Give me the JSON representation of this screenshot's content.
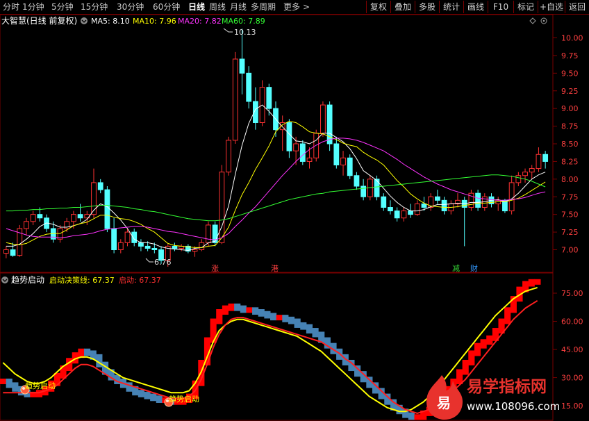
{
  "toolbar": {
    "periods": [
      "分时",
      "1分钟",
      "5分钟",
      "15分钟",
      "30分钟",
      "60分钟",
      "日线",
      "周线",
      "月线",
      "多周期",
      "更多"
    ],
    "active_period": "日线",
    "more_arrow": ">",
    "right_buttons": [
      "复权",
      "叠加",
      "多股",
      "统计",
      "画线",
      "F10",
      "标记",
      "+自选",
      "返回"
    ]
  },
  "main_panel": {
    "title": "大智慧(日线 前复权)",
    "ma": [
      {
        "label": "MA5: 8.10",
        "color": "#ffffff"
      },
      {
        "label": "MA10: 7.96",
        "color": "#ffff00"
      },
      {
        "label": "MA20: 7.82",
        "color": "#ff33ff"
      },
      {
        "label": "MA60: 7.89",
        "color": "#33ff33"
      }
    ],
    "high_label": "10.13",
    "low_label": "6.76",
    "yticks": [
      "10.00",
      "9.75",
      "9.50",
      "9.25",
      "9.00",
      "8.75",
      "8.50",
      "8.25",
      "8.00",
      "7.75",
      "7.50",
      "7.25",
      "7.00"
    ],
    "markers": [
      {
        "text": "涨",
        "color": "#ff4040"
      },
      {
        "text": "港",
        "color": "#ff4040"
      },
      {
        "text": "减",
        "color": "#33cc33"
      },
      {
        "text": "财",
        "color": "#3399ff"
      }
    ]
  },
  "sub_panel": {
    "title": "趋势启动",
    "line_label": "启动决策线: 67.37",
    "value_label": "启动: 67.37",
    "yticks": [
      "75.00",
      "60.00",
      "45.00",
      "30.00",
      "15.00"
    ],
    "signal_label": "趋势启动",
    "signal_label_2": "趋势启动"
  },
  "watermark": {
    "char": "易",
    "name": "易学指标网",
    "url": "www.108096.com"
  },
  "colors": {
    "up": "#ff3232",
    "down": "#54ffff",
    "grid_border": "#7a0000",
    "decision_line": "#ffff00",
    "start_line": "#ff2020",
    "bar_up": "#ff0000",
    "bar_down": "#4682b4"
  },
  "chart_data": [
    {
      "type": "candlestick",
      "title": "大智慧(日线 前复权)",
      "ylim": [
        6.7,
        10.3
      ],
      "ohlc": [
        [
          6.95,
          7.05,
          6.88,
          7.0
        ],
        [
          7.0,
          7.1,
          6.9,
          6.92
        ],
        [
          6.92,
          7.35,
          6.9,
          7.3
        ],
        [
          7.3,
          7.45,
          7.2,
          7.4
        ],
        [
          7.4,
          7.55,
          7.35,
          7.5
        ],
        [
          7.5,
          7.6,
          7.4,
          7.45
        ],
        [
          7.45,
          7.5,
          7.25,
          7.3
        ],
        [
          7.3,
          7.4,
          7.1,
          7.15
        ],
        [
          7.15,
          7.35,
          7.1,
          7.3
        ],
        [
          7.3,
          7.45,
          7.25,
          7.4
        ],
        [
          7.4,
          7.55,
          7.3,
          7.5
        ],
        [
          7.5,
          7.65,
          7.4,
          7.45
        ],
        [
          7.45,
          7.55,
          7.35,
          7.5
        ],
        [
          7.5,
          8.15,
          7.45,
          7.95
        ],
        [
          7.95,
          8.0,
          7.8,
          7.85
        ],
        [
          7.85,
          7.9,
          7.25,
          7.3
        ],
        [
          7.3,
          7.45,
          6.95,
          7.0
        ],
        [
          7.0,
          7.15,
          6.95,
          7.1
        ],
        [
          7.1,
          7.3,
          7.05,
          7.25
        ],
        [
          7.25,
          7.3,
          7.05,
          7.1
        ],
        [
          7.1,
          7.15,
          6.98,
          7.05
        ],
        [
          7.05,
          7.12,
          6.98,
          7.02
        ],
        [
          7.02,
          7.1,
          6.95,
          7.0
        ],
        [
          7.0,
          7.05,
          6.8,
          6.85
        ],
        [
          6.85,
          7.08,
          6.76,
          7.05
        ],
        [
          7.05,
          7.1,
          6.98,
          7.02
        ],
        [
          7.02,
          7.08,
          6.98,
          7.05
        ],
        [
          7.05,
          7.08,
          6.95,
          6.98
        ],
        [
          6.98,
          7.05,
          6.9,
          7.0
        ],
        [
          7.0,
          7.15,
          6.98,
          7.1
        ],
        [
          7.1,
          7.4,
          7.05,
          7.35
        ],
        [
          7.35,
          7.4,
          7.05,
          7.1
        ],
        [
          7.1,
          8.2,
          7.08,
          8.1
        ],
        [
          8.1,
          8.6,
          8.05,
          8.55
        ],
        [
          8.55,
          9.8,
          8.5,
          9.7
        ],
        [
          9.7,
          10.13,
          9.2,
          9.5
        ],
        [
          9.5,
          9.6,
          9.0,
          9.1
        ],
        [
          9.1,
          9.3,
          8.7,
          8.8
        ],
        [
          8.8,
          9.4,
          8.75,
          9.3
        ],
        [
          9.3,
          9.35,
          8.9,
          9.0
        ],
        [
          9.0,
          9.1,
          8.6,
          8.7
        ],
        [
          8.7,
          8.9,
          8.4,
          8.8
        ],
        [
          8.8,
          8.85,
          8.3,
          8.4
        ],
        [
          8.4,
          8.6,
          8.2,
          8.5
        ],
        [
          8.5,
          8.55,
          8.2,
          8.25
        ],
        [
          8.25,
          8.45,
          8.15,
          8.3
        ],
        [
          8.3,
          8.7,
          8.25,
          8.65
        ],
        [
          8.65,
          9.1,
          8.6,
          9.05
        ],
        [
          9.05,
          9.1,
          8.4,
          8.5
        ],
        [
          8.5,
          8.6,
          8.15,
          8.2
        ],
        [
          8.2,
          8.4,
          8.05,
          8.3
        ],
        [
          8.3,
          8.35,
          8.0,
          8.05
        ],
        [
          8.05,
          8.1,
          7.85,
          7.9
        ],
        [
          7.9,
          8.0,
          7.7,
          7.75
        ],
        [
          7.75,
          8.05,
          7.7,
          8.0
        ],
        [
          8.0,
          8.05,
          7.7,
          7.75
        ],
        [
          7.75,
          7.8,
          7.55,
          7.6
        ],
        [
          7.6,
          7.7,
          7.5,
          7.55
        ],
        [
          7.55,
          7.6,
          7.4,
          7.45
        ],
        [
          7.45,
          7.6,
          7.4,
          7.55
        ],
        [
          7.55,
          7.65,
          7.45,
          7.5
        ],
        [
          7.5,
          7.7,
          7.48,
          7.65
        ],
        [
          7.65,
          7.75,
          7.55,
          7.6
        ],
        [
          7.6,
          7.8,
          7.55,
          7.75
        ],
        [
          7.75,
          7.85,
          7.65,
          7.7
        ],
        [
          7.7,
          7.75,
          7.5,
          7.55
        ],
        [
          7.55,
          7.7,
          7.5,
          7.65
        ],
        [
          7.65,
          7.8,
          7.6,
          7.7
        ],
        [
          7.7,
          7.75,
          7.05,
          7.6
        ],
        [
          7.6,
          7.85,
          7.55,
          7.8
        ],
        [
          7.8,
          7.85,
          7.55,
          7.6
        ],
        [
          7.6,
          7.8,
          7.55,
          7.75
        ],
        [
          7.75,
          7.8,
          7.6,
          7.65
        ],
        [
          7.65,
          7.75,
          7.55,
          7.7
        ],
        [
          7.7,
          7.72,
          7.52,
          7.55
        ],
        [
          7.55,
          8.05,
          7.5,
          7.95
        ],
        [
          7.95,
          8.1,
          7.9,
          8.05
        ],
        [
          8.05,
          8.15,
          7.95,
          8.1
        ],
        [
          8.1,
          8.2,
          8.0,
          8.15
        ],
        [
          8.15,
          8.45,
          8.1,
          8.35
        ],
        [
          8.35,
          8.4,
          8.15,
          8.25
        ]
      ],
      "series": [
        {
          "name": "MA5",
          "values": [
            7.05,
            7.05,
            7.08,
            7.15,
            7.23,
            7.33,
            7.38,
            7.36,
            7.32,
            7.32,
            7.34,
            7.37,
            7.43,
            7.56,
            7.65,
            7.61,
            7.52,
            7.42,
            7.3,
            7.15,
            7.1,
            7.1,
            7.08,
            7.04,
            7.02,
            7.01,
            7.0,
            6.99,
            7.02,
            7.03,
            7.1,
            7.12,
            7.33,
            7.62,
            8.07,
            8.48,
            8.79,
            8.99,
            9.05,
            8.96,
            8.85,
            8.74,
            8.64,
            8.54,
            8.53,
            8.5,
            8.55,
            8.65,
            8.65,
            8.59,
            8.53,
            8.43,
            8.29,
            8.12,
            8.05,
            7.98,
            7.87,
            7.76,
            7.67,
            7.6,
            7.55,
            7.55,
            7.57,
            7.61,
            7.64,
            7.64,
            7.65,
            7.66,
            7.65,
            7.67,
            7.67,
            7.68,
            7.7,
            7.71,
            7.68,
            7.72,
            7.8,
            7.9,
            8.0,
            8.06,
            8.1
          ]
        },
        {
          "name": "MA10",
          "values": [
            7.1,
            7.08,
            7.07,
            7.09,
            7.14,
            7.19,
            7.22,
            7.23,
            7.23,
            7.28,
            7.34,
            7.37,
            7.39,
            7.44,
            7.49,
            7.49,
            7.46,
            7.44,
            7.43,
            7.4,
            7.36,
            7.3,
            7.25,
            7.17,
            7.09,
            7.06,
            7.05,
            7.04,
            7.03,
            7.03,
            7.05,
            7.06,
            7.17,
            7.32,
            7.56,
            7.78,
            7.95,
            8.14,
            8.3,
            8.47,
            8.67,
            8.77,
            8.82,
            8.8,
            8.74,
            8.67,
            8.65,
            8.64,
            8.6,
            8.56,
            8.51,
            8.48,
            8.46,
            8.38,
            8.32,
            8.27,
            8.2,
            8.09,
            7.98,
            7.89,
            7.79,
            7.72,
            7.66,
            7.62,
            7.61,
            7.6,
            7.6,
            7.61,
            7.63,
            7.64,
            7.66,
            7.66,
            7.67,
            7.68,
            7.68,
            7.7,
            7.73,
            7.78,
            7.84,
            7.9,
            7.96
          ]
        },
        {
          "name": "MA20",
          "values": [
            7.3,
            7.27,
            7.24,
            7.21,
            7.19,
            7.18,
            7.18,
            7.18,
            7.17,
            7.18,
            7.2,
            7.21,
            7.22,
            7.24,
            7.27,
            7.29,
            7.3,
            7.31,
            7.32,
            7.33,
            7.33,
            7.32,
            7.3,
            7.28,
            7.26,
            7.25,
            7.23,
            7.21,
            7.19,
            7.17,
            7.15,
            7.14,
            7.17,
            7.23,
            7.33,
            7.42,
            7.52,
            7.61,
            7.72,
            7.83,
            7.94,
            8.05,
            8.15,
            8.25,
            8.34,
            8.42,
            8.48,
            8.53,
            8.56,
            8.58,
            8.58,
            8.57,
            8.55,
            8.52,
            8.48,
            8.44,
            8.4,
            8.34,
            8.28,
            8.21,
            8.15,
            8.09,
            8.03,
            7.98,
            7.93,
            7.89,
            7.85,
            7.82,
            7.79,
            7.76,
            7.73,
            7.72,
            7.71,
            7.7,
            7.7,
            7.71,
            7.72,
            7.74,
            7.77,
            7.8,
            7.82
          ]
        },
        {
          "name": "MA60",
          "values": [
            7.55,
            7.55,
            7.56,
            7.56,
            7.57,
            7.57,
            7.58,
            7.58,
            7.59,
            7.59,
            7.6,
            7.6,
            7.61,
            7.62,
            7.63,
            7.63,
            7.62,
            7.61,
            7.6,
            7.58,
            7.57,
            7.55,
            7.54,
            7.52,
            7.5,
            7.48,
            7.46,
            7.44,
            7.43,
            7.42,
            7.41,
            7.41,
            7.42,
            7.44,
            7.47,
            7.5,
            7.53,
            7.56,
            7.59,
            7.62,
            7.65,
            7.68,
            7.71,
            7.73,
            7.75,
            7.77,
            7.79,
            7.8,
            7.82,
            7.83,
            7.84,
            7.85,
            7.86,
            7.87,
            7.88,
            7.89,
            7.9,
            7.91,
            7.92,
            7.93,
            7.94,
            7.95,
            7.96,
            7.97,
            7.98,
            7.99,
            8.0,
            8.01,
            8.02,
            8.03,
            8.04,
            8.05,
            8.06,
            8.06,
            8.05,
            8.04,
            8.02,
            8.0,
            7.97,
            7.93,
            7.89
          ]
        }
      ]
    },
    {
      "type": "bar",
      "title": "趋势启动",
      "ylim": [
        8,
        85
      ],
      "values": [
        28,
        26,
        24,
        22,
        21,
        21,
        22,
        24,
        27,
        31,
        35,
        39,
        42,
        44,
        43,
        41,
        37,
        33,
        30,
        28,
        26,
        24,
        22,
        21,
        20,
        19,
        18,
        18,
        17,
        17,
        18,
        20,
        27,
        38,
        50,
        60,
        65,
        67,
        68,
        67,
        66,
        66,
        65,
        64,
        63,
        62,
        62,
        61,
        60,
        58,
        57,
        55,
        53,
        50,
        47,
        44,
        41,
        38,
        35,
        32,
        29,
        26,
        23,
        20,
        17,
        14,
        12,
        10,
        9,
        9,
        11,
        13,
        16,
        20,
        24,
        28,
        33,
        38,
        43,
        47,
        49,
        51,
        55,
        60,
        66,
        72,
        77,
        80,
        81,
        81
      ],
      "series": [
        {
          "name": "启动决策线",
          "values": [
            38,
            35,
            32,
            30,
            28,
            27,
            27,
            28,
            30,
            33,
            36,
            38,
            40,
            41,
            41,
            40,
            38,
            36,
            34,
            32,
            30,
            29,
            28,
            27,
            26,
            25,
            24,
            23,
            22,
            22,
            22,
            23,
            27,
            33,
            41,
            49,
            55,
            58,
            60,
            61,
            61,
            60,
            59,
            58,
            57,
            56,
            55,
            54,
            53,
            52,
            50,
            48,
            46,
            44,
            41,
            38,
            35,
            32,
            29,
            26,
            23,
            20,
            18,
            16,
            14,
            13,
            12,
            12,
            13,
            15,
            17,
            20,
            23,
            27,
            31,
            35,
            39,
            43,
            47,
            51,
            55,
            59,
            63,
            66,
            69,
            72,
            74,
            76,
            77,
            78
          ]
        },
        {
          "name": "启动",
          "values": [
            22,
            22,
            22,
            22,
            22,
            22,
            22,
            23,
            24,
            26,
            29,
            32,
            35,
            37,
            37,
            36,
            34,
            32,
            30,
            28,
            27,
            26,
            25,
            24,
            23,
            22,
            21,
            20,
            19,
            19,
            19,
            20,
            23,
            29,
            37,
            46,
            53,
            58,
            61,
            62,
            62,
            61,
            60,
            59,
            58,
            57,
            56,
            55,
            54,
            53,
            52,
            51,
            50,
            49,
            47,
            45,
            43,
            40,
            38,
            35,
            32,
            29,
            26,
            23,
            20,
            17,
            15,
            13,
            12,
            11,
            12,
            13,
            15,
            17,
            20,
            23,
            26,
            29,
            33,
            37,
            41,
            45,
            49,
            53,
            57,
            61,
            64,
            67,
            69,
            71
          ]
        }
      ]
    }
  ]
}
